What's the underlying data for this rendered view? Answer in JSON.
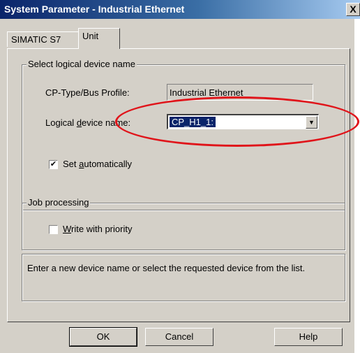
{
  "window": {
    "title": "System Parameter - Industrial Ethernet",
    "close_label": "X"
  },
  "tabs": [
    {
      "label": "SIMATIC S7",
      "active": false
    },
    {
      "label": "Unit",
      "active": true
    }
  ],
  "logical_device_group": {
    "legend": "Select logical device name",
    "cp_type_label": "CP-Type/Bus Profile:",
    "cp_type_value": "Industrial Ethernet",
    "device_name_label_pre": "Logical ",
    "device_name_label_mnemonic": "d",
    "device_name_label_post": "evice name:",
    "device_name_value": "CP_H1_1:",
    "set_auto_pre": "Set ",
    "set_auto_mnemonic": "a",
    "set_auto_post": "utomatically",
    "set_auto_checked": true,
    "check_mark": "✔"
  },
  "job_group": {
    "legend": "Job processing",
    "priority_mnemonic": "W",
    "priority_post": "rite with priority",
    "priority_checked": false
  },
  "info": {
    "text": "Enter a new device name or select the requested device from the list."
  },
  "buttons": {
    "ok": "OK",
    "cancel": "Cancel",
    "help": "Help"
  },
  "icons": {
    "dropdown": "chevron-down-icon",
    "close": "close-icon"
  },
  "colors": {
    "title_start": "#0a246a",
    "title_end": "#a6caf0",
    "dialog_face": "#d4d0c8",
    "highlight": "#e0141a"
  }
}
